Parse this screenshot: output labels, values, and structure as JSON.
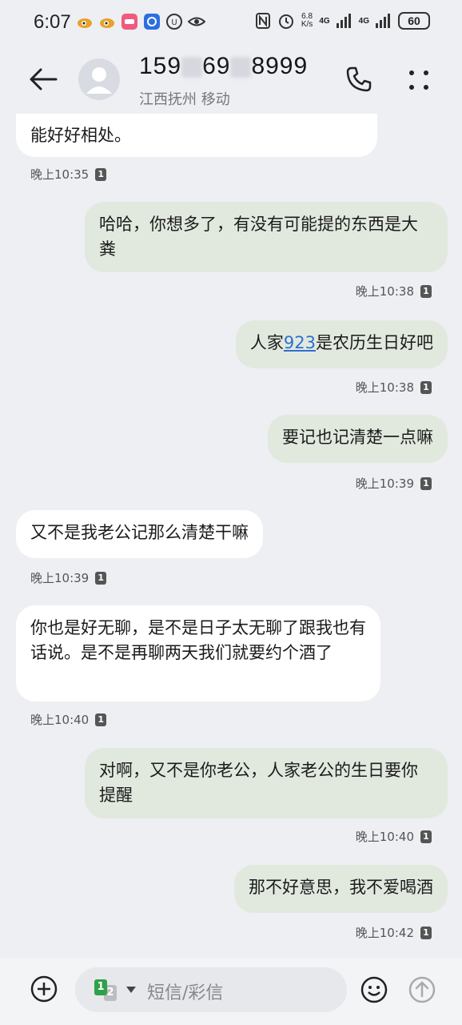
{
  "status_bar": {
    "time": "6:07",
    "net_speed_value": "6.8",
    "net_speed_unit": "K/s",
    "signal1_label": "4G",
    "signal2_label": "4G",
    "battery": "60"
  },
  "header": {
    "contact_number_part1": "159",
    "contact_number_part2": "69",
    "contact_number_part3": "8999",
    "contact_location": "江西抚州 移动"
  },
  "messages": [
    {
      "direction": "in",
      "text": "能好好相处。",
      "time": "晚上10:35",
      "sim": "1"
    },
    {
      "direction": "out",
      "text": "哈哈，你想多了，有没有可能提的东西是大粪",
      "time": "晚上10:38",
      "sim": "1"
    },
    {
      "direction": "out",
      "text_before": "人家",
      "link": "923",
      "text_after": "是农历生日好吧",
      "time": "晚上10:38",
      "sim": "1"
    },
    {
      "direction": "out",
      "text": "要记也记清楚一点嘛",
      "time": "晚上10:39",
      "sim": "1"
    },
    {
      "direction": "in",
      "text": "又不是我老公记那么清楚干嘛",
      "time": "晚上10:39",
      "sim": "1"
    },
    {
      "direction": "in",
      "text": "你也是好无聊，是不是日子太无聊了跟我也有话说。是不是再聊两天我们就要约个酒了",
      "time": "晚上10:40",
      "sim": "1"
    },
    {
      "direction": "out",
      "text": "对啊，又不是你老公，人家老公的生日要你提醒",
      "time": "晚上10:40",
      "sim": "1"
    },
    {
      "direction": "out",
      "text": "那不好意思，我不爱喝酒",
      "time": "晚上10:42",
      "sim": "1"
    }
  ],
  "input_bar": {
    "sim_primary": "1",
    "sim_secondary": "2",
    "placeholder": "短信/彩信"
  },
  "colors": {
    "background": "#edeff3",
    "incoming_bubble": "#ffffff",
    "outgoing_bubble": "#e1e9df",
    "link": "#2e6fd1",
    "sim_active": "#2fa14a"
  }
}
